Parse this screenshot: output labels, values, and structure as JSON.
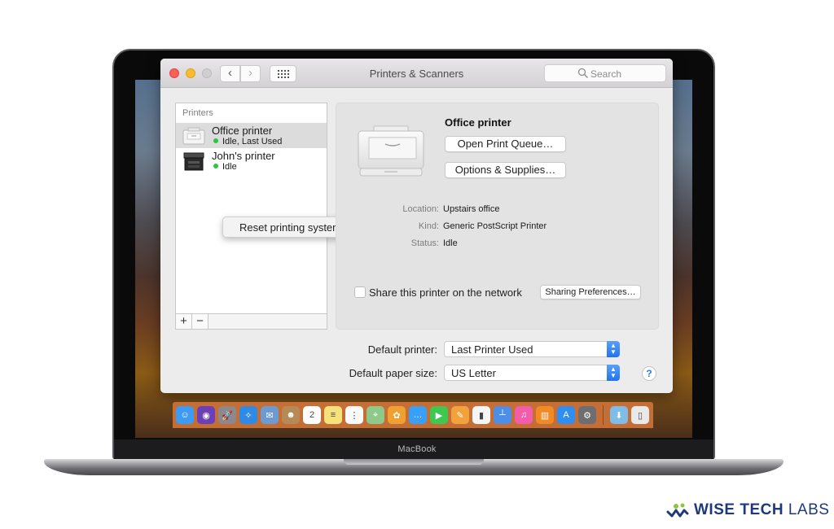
{
  "window": {
    "title": "Printers & Scanners",
    "search_placeholder": "Search",
    "nav": {
      "back": "‹",
      "forward": "›"
    }
  },
  "sidebar": {
    "header": "Printers",
    "printers": [
      {
        "name": "Office printer",
        "status": "Idle, Last Used",
        "selected": true,
        "icon": "laser-printer-icon"
      },
      {
        "name": "John's printer",
        "status": "Idle",
        "selected": false,
        "icon": "multifunction-printer-icon"
      }
    ],
    "add_label": "+",
    "remove_label": "−"
  },
  "context_menu": {
    "item": "Reset printing system…"
  },
  "detail": {
    "printer_name": "Office printer",
    "open_queue": "Open Print Queue…",
    "options_supplies": "Options & Supplies…",
    "info": [
      {
        "key": "Location:",
        "value": "Upstairs office"
      },
      {
        "key": "Kind:",
        "value": "Generic PostScript Printer"
      },
      {
        "key": "Status:",
        "value": "Idle"
      }
    ],
    "share_label": "Share this printer on the network",
    "share_checked": false,
    "sharing_prefs": "Sharing Preferences…"
  },
  "defaults": {
    "printer_label": "Default printer:",
    "printer_value": "Last Printer Used",
    "paper_label": "Default paper size:",
    "paper_value": "US Letter",
    "help": "?"
  },
  "dock": {
    "apps": [
      {
        "name": "finder",
        "color": "#3d9bf5",
        "glyph": "☺"
      },
      {
        "name": "siri",
        "color": "#6b3fb5",
        "glyph": "◉"
      },
      {
        "name": "launchpad",
        "color": "#8a8a8e",
        "glyph": "🚀"
      },
      {
        "name": "safari",
        "color": "#2f8ae6",
        "glyph": "✧"
      },
      {
        "name": "mail",
        "color": "#6d9bd1",
        "glyph": "✉"
      },
      {
        "name": "contacts",
        "color": "#b58a56",
        "glyph": "☻"
      },
      {
        "name": "calendar",
        "color": "#ffffff",
        "glyph": "2"
      },
      {
        "name": "notes",
        "color": "#f6e27a",
        "glyph": "≡"
      },
      {
        "name": "reminders",
        "color": "#fafafa",
        "glyph": "⋮"
      },
      {
        "name": "maps",
        "color": "#8fc98a",
        "glyph": "⌖"
      },
      {
        "name": "photos",
        "color": "#f0a030",
        "glyph": "✿"
      },
      {
        "name": "messages",
        "color": "#3aa0f7",
        "glyph": "…"
      },
      {
        "name": "facetime",
        "color": "#3ec751",
        "glyph": "▶"
      },
      {
        "name": "pages",
        "color": "#f2a23a",
        "glyph": "✎"
      },
      {
        "name": "numbers",
        "color": "#f5f5f5",
        "glyph": "▮"
      },
      {
        "name": "keynote",
        "color": "#4d8ee6",
        "glyph": "┴"
      },
      {
        "name": "itunes",
        "color": "#f25ca8",
        "glyph": "♫"
      },
      {
        "name": "ibooks",
        "color": "#f08a24",
        "glyph": "▥"
      },
      {
        "name": "app-store",
        "color": "#2f8ef0",
        "glyph": "A"
      },
      {
        "name": "system-preferences",
        "color": "#6e6e72",
        "glyph": "⚙"
      }
    ],
    "stack": [
      {
        "name": "downloads",
        "color": "#7fbde8",
        "glyph": "⬇"
      },
      {
        "name": "trash",
        "color": "#e9e9ea",
        "glyph": "▯"
      }
    ]
  },
  "laptop": {
    "label": "MacBook"
  },
  "brand": {
    "word1": "WISE TECH",
    "word2": "LABS"
  }
}
